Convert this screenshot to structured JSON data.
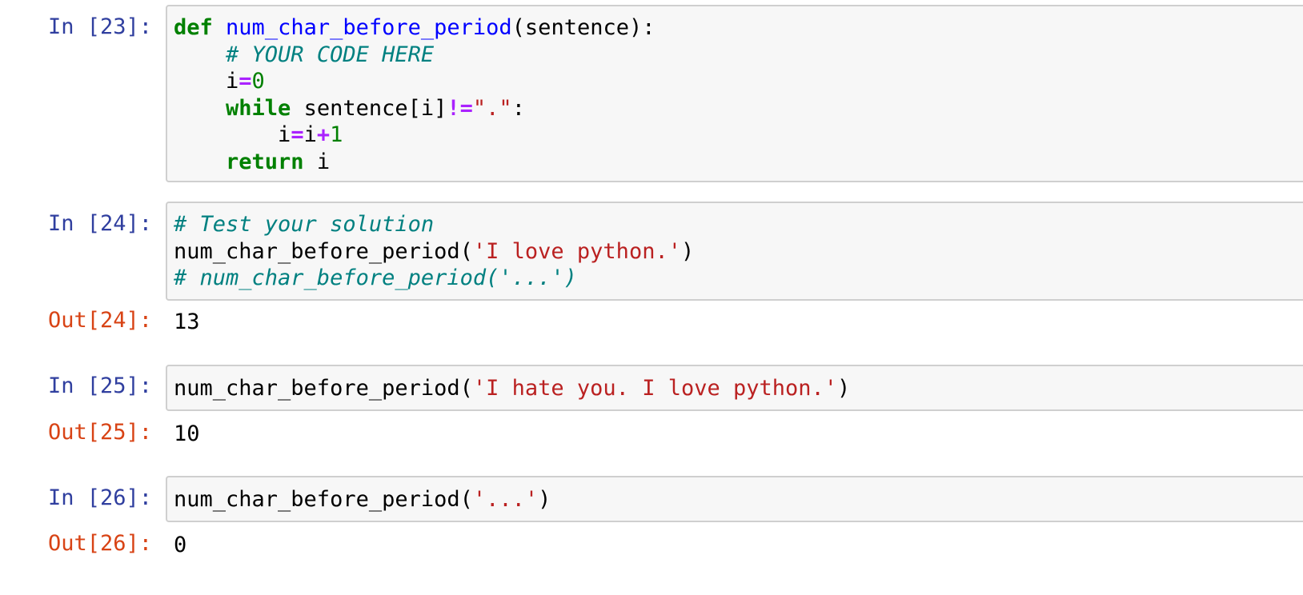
{
  "cells": [
    {
      "in_prompt": "In [23]:",
      "lines": [
        [
          [
            "kw",
            "def"
          ],
          [
            "txt",
            " "
          ],
          [
            "fn",
            "num_char_before_period"
          ],
          [
            "txt",
            "(sentence):"
          ]
        ],
        [
          [
            "txt",
            "    "
          ],
          [
            "cm",
            "# YOUR CODE HERE"
          ]
        ],
        [
          [
            "txt",
            "    i"
          ],
          [
            "op",
            "="
          ],
          [
            "num",
            "0"
          ]
        ],
        [
          [
            "txt",
            "    "
          ],
          [
            "kw",
            "while"
          ],
          [
            "txt",
            " sentence[i]"
          ],
          [
            "op",
            "!="
          ],
          [
            "str",
            "\".\""
          ],
          [
            "txt",
            ":"
          ]
        ],
        [
          [
            "txt",
            "        i"
          ],
          [
            "op",
            "="
          ],
          [
            "txt",
            "i"
          ],
          [
            "op",
            "+"
          ],
          [
            "num",
            "1"
          ]
        ],
        [
          [
            "txt",
            "    "
          ],
          [
            "kw",
            "return"
          ],
          [
            "txt",
            " i"
          ]
        ]
      ]
    },
    {
      "in_prompt": "In [24]:",
      "lines": [
        [
          [
            "cm",
            "# Test your solution"
          ]
        ],
        [
          [
            "txt",
            "num_char_before_period("
          ],
          [
            "str",
            "'I love python.'"
          ],
          [
            "txt",
            ")"
          ]
        ],
        [
          [
            "cm",
            "# num_char_before_period('...')"
          ]
        ]
      ],
      "out_prompt": "Out[24]:",
      "output": "13"
    },
    {
      "in_prompt": "In [25]:",
      "lines": [
        [
          [
            "txt",
            "num_char_before_period("
          ],
          [
            "str",
            "'I hate you. I love python.'"
          ],
          [
            "txt",
            ")"
          ]
        ]
      ],
      "out_prompt": "Out[25]:",
      "output": "10"
    },
    {
      "in_prompt": "In [26]:",
      "lines": [
        [
          [
            "txt",
            "num_char_before_period("
          ],
          [
            "str",
            "'...'"
          ],
          [
            "txt",
            ")"
          ]
        ]
      ],
      "out_prompt": "Out[26]:",
      "output": "0"
    }
  ],
  "colors": {
    "in_prompt": "#303f9f",
    "out_prompt": "#d84315",
    "keyword": "#008000",
    "function": "#0000ff",
    "comment": "#008080",
    "operator": "#aa22ff",
    "number": "#008000",
    "string": "#ba2121",
    "cell_background": "#f7f7f7",
    "cell_border": "#cfcfcf"
  }
}
